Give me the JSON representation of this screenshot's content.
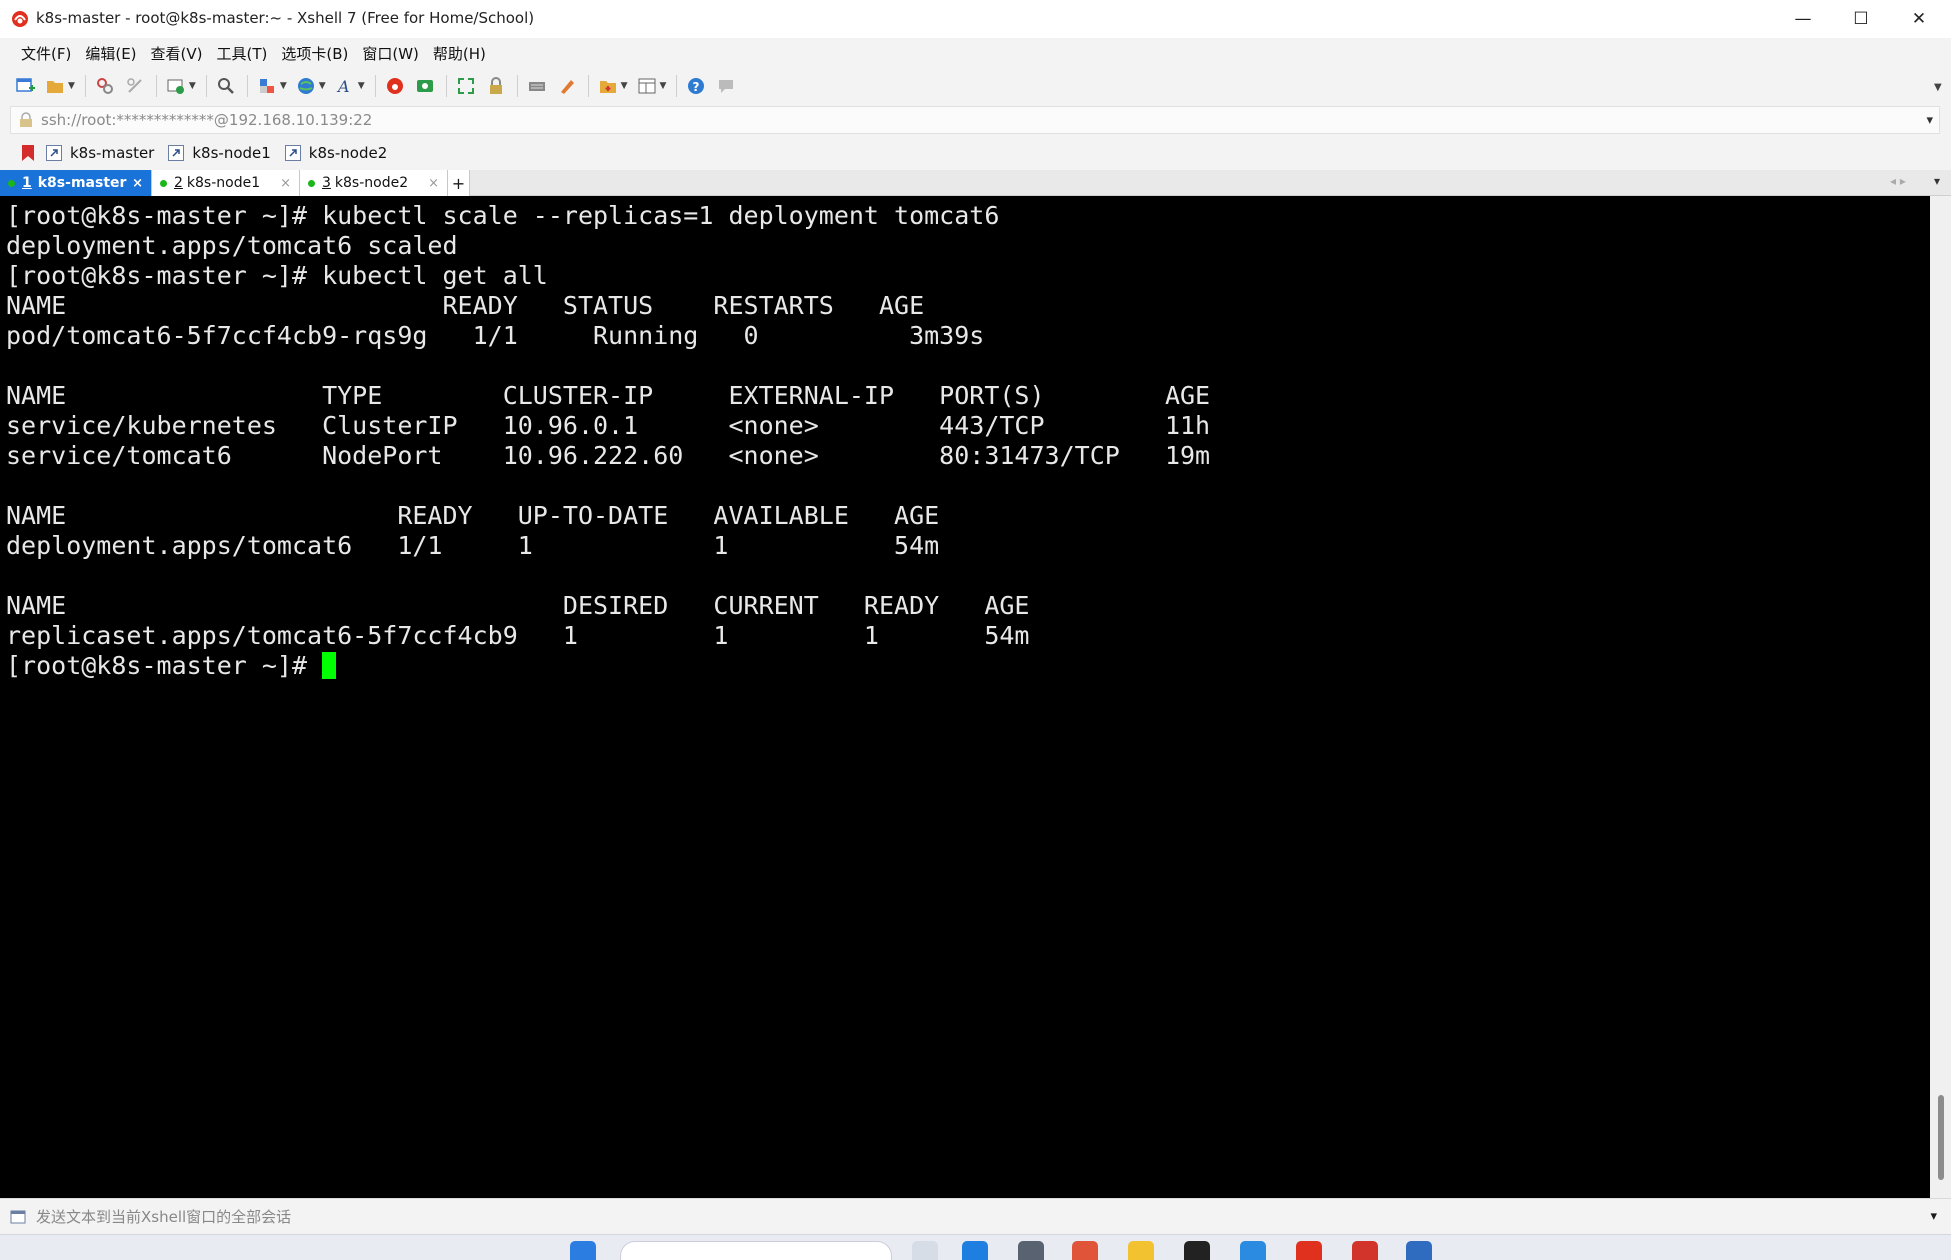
{
  "window": {
    "title": "k8s-master - root@k8s-master:~ - Xshell 7 (Free for Home/School)",
    "minimize": "—",
    "maximize": "☐",
    "close": "✕"
  },
  "menu": [
    "文件(F)",
    "编辑(E)",
    "查看(V)",
    "工具(T)",
    "选项卡(B)",
    "窗口(W)",
    "帮助(H)"
  ],
  "address": {
    "value": "ssh://root:*************@192.168.10.139:22",
    "dropdown": "▾"
  },
  "links": [
    "k8s-master",
    "k8s-node1",
    "k8s-node2"
  ],
  "tabs": [
    {
      "number": "1",
      "label": "k8s-master",
      "close": "×"
    },
    {
      "number": "2",
      "label": "k8s-node1",
      "close": "×"
    },
    {
      "number": "3",
      "label": "k8s-node2",
      "close": "×"
    }
  ],
  "new_tab": "+",
  "tab_nav": "◂ ▸",
  "tab_menu": "▾",
  "terminal": {
    "lines": [
      "[root@k8s-master ~]# kubectl scale --replicas=1 deployment tomcat6",
      "deployment.apps/tomcat6 scaled",
      "[root@k8s-master ~]# kubectl get all",
      "NAME                         READY   STATUS    RESTARTS   AGE",
      "pod/tomcat6-5f7ccf4cb9-rqs9g   1/1     Running   0          3m39s",
      "",
      "NAME                 TYPE        CLUSTER-IP     EXTERNAL-IP   PORT(S)        AGE",
      "service/kubernetes   ClusterIP   10.96.0.1      <none>        443/TCP        11h",
      "service/tomcat6      NodePort    10.96.222.60   <none>        80:31473/TCP   19m",
      "",
      "NAME                      READY   UP-TO-DATE   AVAILABLE   AGE",
      "deployment.apps/tomcat6   1/1     1            1           54m",
      "",
      "NAME                                 DESIRED   CURRENT   READY   AGE",
      "replicaset.apps/tomcat6-5f7ccf4cb9   1         1         1       54m"
    ],
    "prompt": "[root@k8s-master ~]# "
  },
  "compose": {
    "placeholder": "发送文本到当前Xshell窗口的全部会话",
    "dropdown": "▾"
  },
  "colors": {
    "active_tab": "#1a73d9",
    "cursor": "#00ff00",
    "status_dot": "#19b719",
    "terminal_bg": "#000000"
  }
}
